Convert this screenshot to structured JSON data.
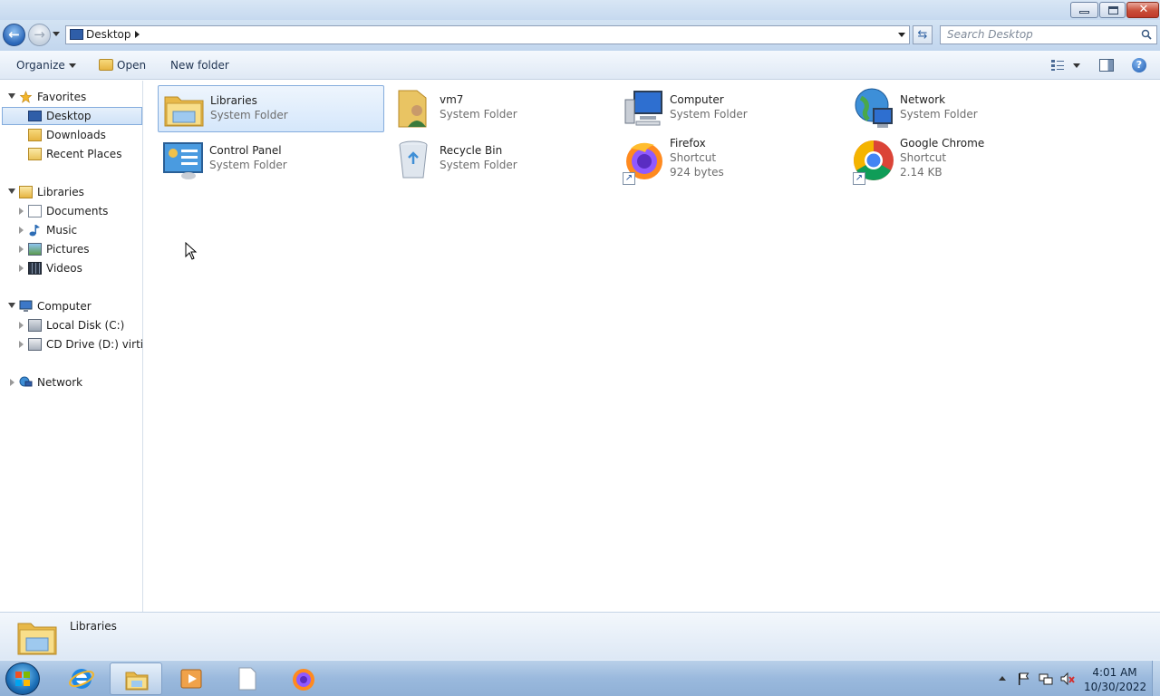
{
  "window": {
    "controls": {
      "minimize": "minimize",
      "maximize": "restore",
      "close": "✕"
    }
  },
  "address_bar": {
    "location": "Desktop",
    "search_placeholder": "Search Desktop"
  },
  "toolbar": {
    "organize_label": "Organize",
    "open_label": "Open",
    "new_folder_label": "New folder"
  },
  "nav_pane": {
    "favorites": {
      "label": "Favorites",
      "items": [
        {
          "label": "Desktop"
        },
        {
          "label": "Downloads"
        },
        {
          "label": "Recent Places"
        }
      ]
    },
    "libraries": {
      "label": "Libraries",
      "items": [
        {
          "label": "Documents"
        },
        {
          "label": "Music"
        },
        {
          "label": "Pictures"
        },
        {
          "label": "Videos"
        }
      ]
    },
    "computer": {
      "label": "Computer",
      "items": [
        {
          "label": "Local Disk (C:)"
        },
        {
          "label": "CD Drive (D:) virtio-w"
        }
      ]
    },
    "network": {
      "label": "Network"
    }
  },
  "content": {
    "items": [
      {
        "name": "Libraries",
        "type": "System Folder",
        "icon": "libraries-icon"
      },
      {
        "name": "vm7",
        "type": "System Folder",
        "icon": "user-folder-icon"
      },
      {
        "name": "Computer",
        "type": "System Folder",
        "icon": "computer-icon"
      },
      {
        "name": "Network",
        "type": "System Folder",
        "icon": "network-icon"
      },
      {
        "name": "Control Panel",
        "type": "System Folder",
        "icon": "control-panel-icon"
      },
      {
        "name": "Recycle Bin",
        "type": "System Folder",
        "icon": "recycle-bin-icon"
      },
      {
        "name": "Firefox",
        "type": "Shortcut",
        "size": "924 bytes",
        "icon": "firefox-icon"
      },
      {
        "name": "Google Chrome",
        "type": "Shortcut",
        "size": "2.14 KB",
        "icon": "chrome-icon"
      }
    ],
    "selected": "Libraries"
  },
  "details_pane": {
    "name": "Libraries"
  },
  "taskbar": {
    "apps": [
      "internet-explorer",
      "windows-explorer",
      "media-player",
      "notepad",
      "firefox"
    ],
    "clock_time": "4:01 AM",
    "clock_date": "10/30/2022"
  },
  "colors": {
    "selection": "#cfe2f7",
    "accent": "#2a66b8",
    "taskbar": "#9ab9dd"
  }
}
